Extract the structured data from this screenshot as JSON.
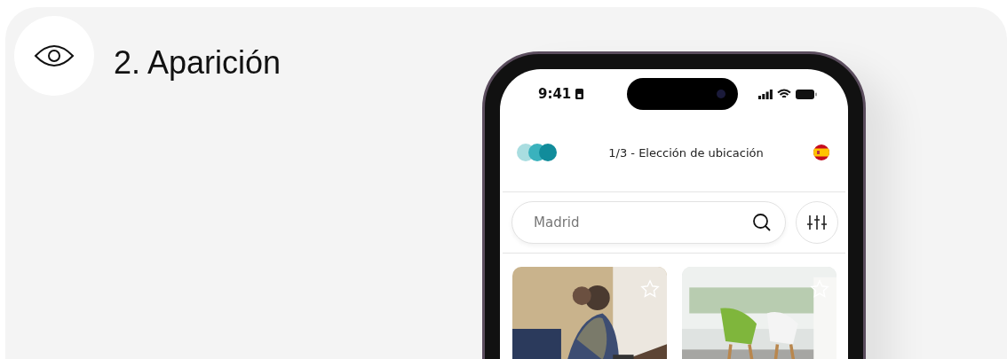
{
  "section": {
    "title": "2. Aparición"
  },
  "phone": {
    "status_bar": {
      "time": "9:41"
    },
    "header": {
      "title": "1/3 - Elección de ubicación"
    },
    "search": {
      "placeholder": "Madrid"
    }
  }
}
